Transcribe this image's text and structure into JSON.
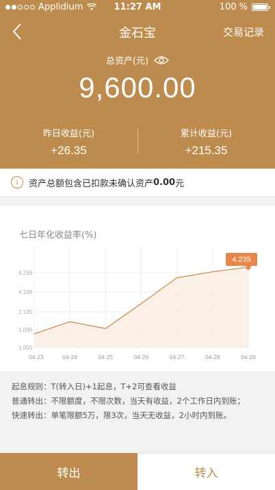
{
  "status_bar": {
    "carrier": "Applidium",
    "time": "11:27 AM",
    "battery": "100 %"
  },
  "nav": {
    "title": "金石宝",
    "right_label": "交易记录"
  },
  "total": {
    "label": "总资产(元)",
    "value": "9,600.00"
  },
  "stats": {
    "yesterday_label": "昨日收益(元)",
    "yesterday_value": "+26.35",
    "cumulative_label": "累计收益(元)",
    "cumulative_value": "+215.35"
  },
  "notice": {
    "prefix": "资产总额包含已扣款未确认资产",
    "amount": "0.00",
    "suffix": "元"
  },
  "chart_title": "七日年化收益率(%)",
  "chart_data": {
    "type": "area",
    "title": "七日年化收益率(%)",
    "x": [
      "04-23",
      "04-24",
      "04-25",
      "04-26",
      "04-27",
      "04-28",
      "04-29"
    ],
    "values": [
      1.9,
      2.7,
      2.25,
      3.9,
      5.6,
      6.0,
      6.3
    ],
    "y_ticks": [
      "1.000",
      "1.096",
      "2.135",
      "4.168",
      "6.269"
    ],
    "highlight": "4.235",
    "colors": {
      "line": "#c8904f",
      "fill": "#fbeee6",
      "point": "#e8874c"
    },
    "grid": true
  },
  "rules": [
    "起息规则：T(转入日)+1起息，T+2可查看收益",
    "普通转出：不限额度，不限次数，当天有收益，2个工作日内到账；",
    "快速转出：单笔限额5万，限3次，当天无收益，2小时内到账。"
  ],
  "buttons": {
    "transfer_out": "转出",
    "transfer_in": "转入"
  },
  "colors": {
    "brand": "#bd8b4d",
    "accent": "#e8874c"
  }
}
